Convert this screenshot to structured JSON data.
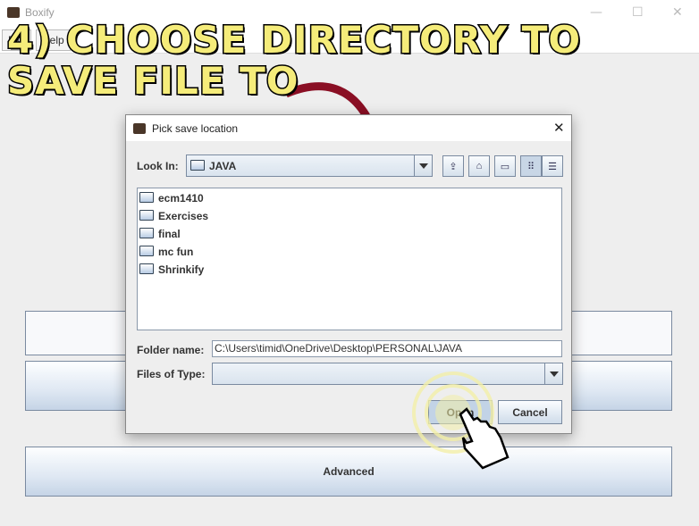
{
  "window": {
    "title": "Boxify",
    "menus": [
      "File",
      "Help"
    ]
  },
  "main_buttons": [
    "",
    "",
    "Advanced"
  ],
  "annotation": {
    "line1": "4) CHOOSE DIRECTORY TO",
    "line2": "SAVE FILE TO",
    "text_color": "#f5ec7a",
    "arrow_color": "#8a0f24"
  },
  "dialog": {
    "title": "Pick save location",
    "look_in_label": "Look In:",
    "look_in_value": "JAVA",
    "files": [
      "ecm1410",
      "Exercises",
      "final",
      "mc fun",
      "Shrinkify"
    ],
    "folder_name_label": "Folder name:",
    "folder_name_value": "C:\\Users\\timid\\OneDrive\\Desktop\\PERSONAL\\JAVA",
    "files_of_type_label": "Files of Type:",
    "files_of_type_value": "",
    "open_label": "Open",
    "cancel_label": "Cancel"
  }
}
